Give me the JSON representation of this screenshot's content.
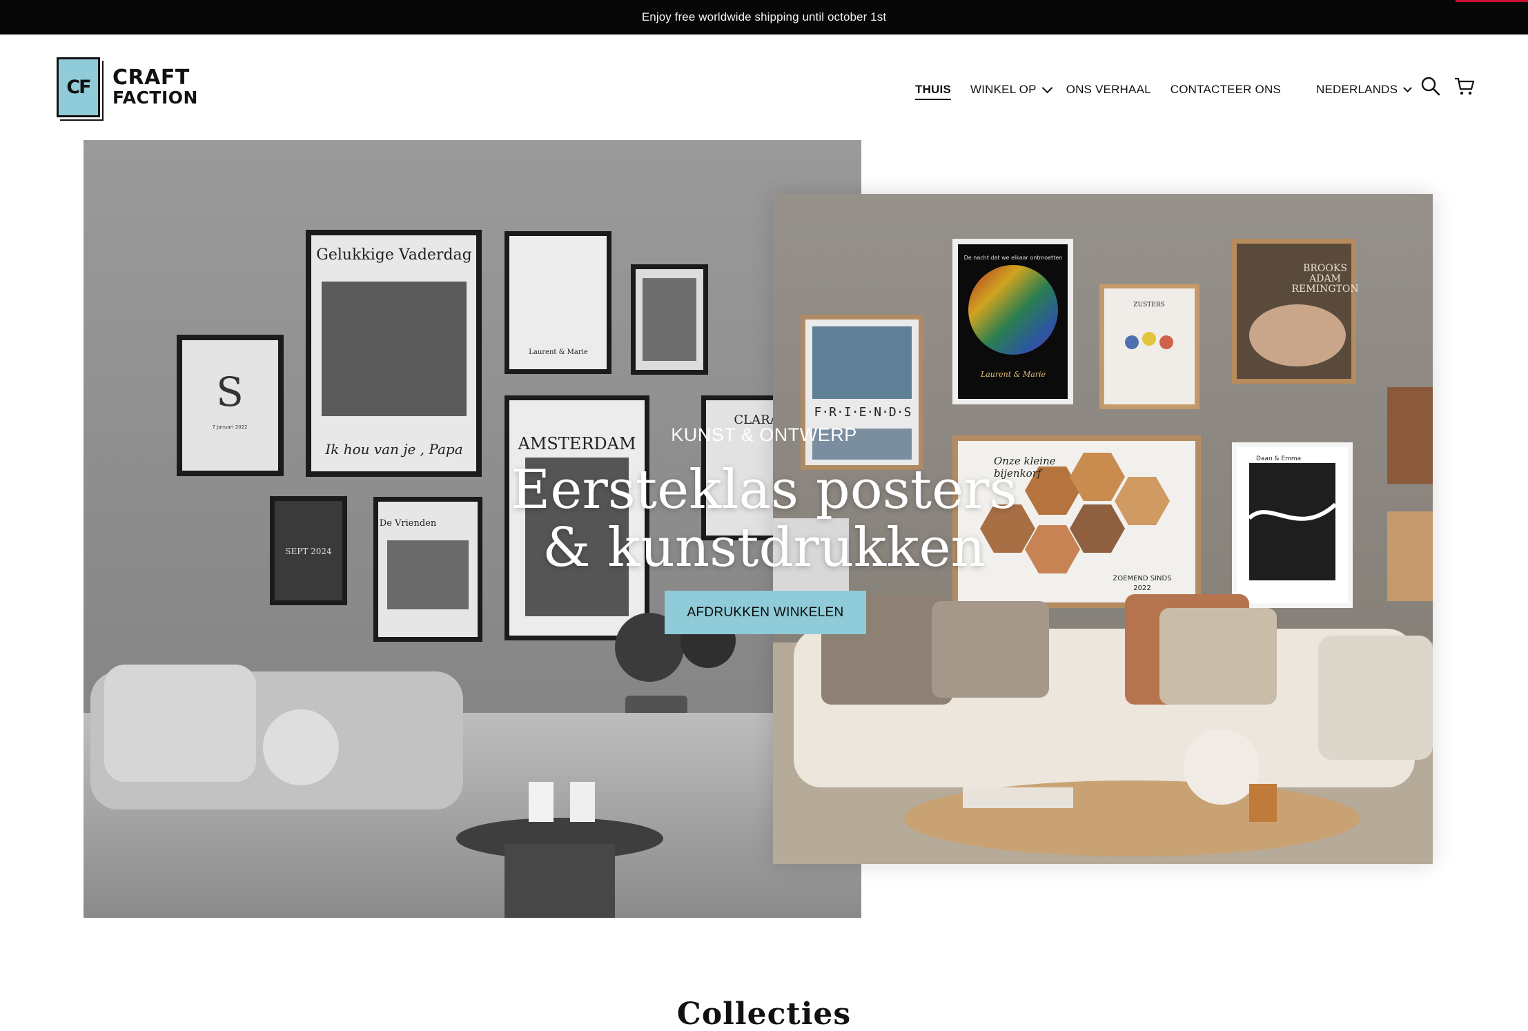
{
  "announcement": {
    "text": "Enjoy free worldwide shipping until october 1st"
  },
  "brand": {
    "mark": "CF",
    "line1": "CRAFT",
    "line2": "FACTION",
    "accent_color": "#8fcbd8"
  },
  "nav": {
    "items": [
      {
        "label": "THUIS",
        "active": true
      },
      {
        "label": "WINKEL OP",
        "dropdown": true
      },
      {
        "label": "ONS VERHAAL"
      },
      {
        "label": "CONTACTEER ONS"
      }
    ],
    "language": "NEDERLANDS",
    "icons": [
      "search-icon",
      "cart-icon"
    ]
  },
  "hero": {
    "eyebrow": "KUNST & ONTWERP",
    "headline_line1": "Eersteklas posters",
    "headline_line2": "& kunstdrukken",
    "cta_label": "AFDRUKKEN WINKELEN",
    "posters_left": {
      "vaderdag_title": "Gelukkige Vaderdag",
      "vaderdag_script": "Ik hou van je , Papa",
      "monogram_letter": "S",
      "monogram_date": "7 Januari 2022",
      "script_names": "Laurent & Marie",
      "amsterdam_title": "AMSTERDAM",
      "vrienden_title": "De Vrienden",
      "sept_date": "SEPT 2024",
      "clara": "CLARA"
    },
    "posters_right": {
      "friends": "F·R·I·E·N·D·S",
      "zusters": "ZUSTERS",
      "brooks_line1": "BROOKS",
      "brooks_line2": "ADAM",
      "brooks_line3": "REMINGTON",
      "bijenkorf_script1": "Onze kleine",
      "bijenkorf_script2": "bijenkorf",
      "zoemend": "ZOEMEND SINDS",
      "zoemend_year": "2022",
      "map_names": "Daan & Emma",
      "laurent_script": "Laurent & Marie",
      "sky_caption": "De nacht dat we elkaar ontmoetten"
    }
  },
  "collections": {
    "title": "Collecties"
  }
}
